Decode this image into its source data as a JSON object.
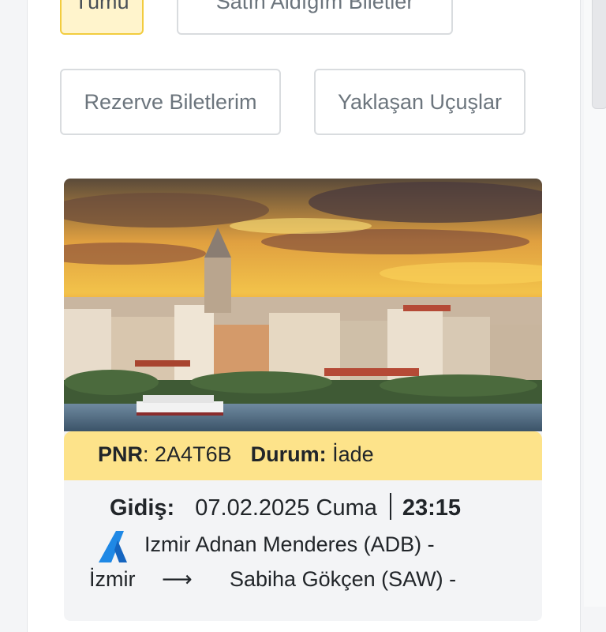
{
  "filters": {
    "all": "Tümü",
    "purchased": "Satın Aldığım Biletler",
    "reserved": "Rezerve Biletlerim",
    "upcoming": "Yaklaşan Uçuşlar"
  },
  "ticket": {
    "pnr_label": "PNR",
    "pnr_value": "2A4T6B",
    "status_label": "Durum:",
    "status_value": "İade",
    "departure_label": "Gidiş:",
    "date": "07.02.2025 Cuma",
    "time": "23:15",
    "origin_airport": "Izmir Adnan Menderes (ADB) -",
    "origin_city": "İzmir",
    "arrow": "⟶",
    "destination_airport": "Sabiha Gökçen (SAW) -"
  },
  "colors": {
    "accent_yellow": "#fde38a",
    "active_filter_bg": "#fff4cc",
    "active_filter_border": "#f2cc3f",
    "airline_logo_blue": "#1f88e5"
  },
  "icons": {
    "airline_logo": "airline-logo-icon",
    "route_arrow": "arrow-right-icon"
  }
}
